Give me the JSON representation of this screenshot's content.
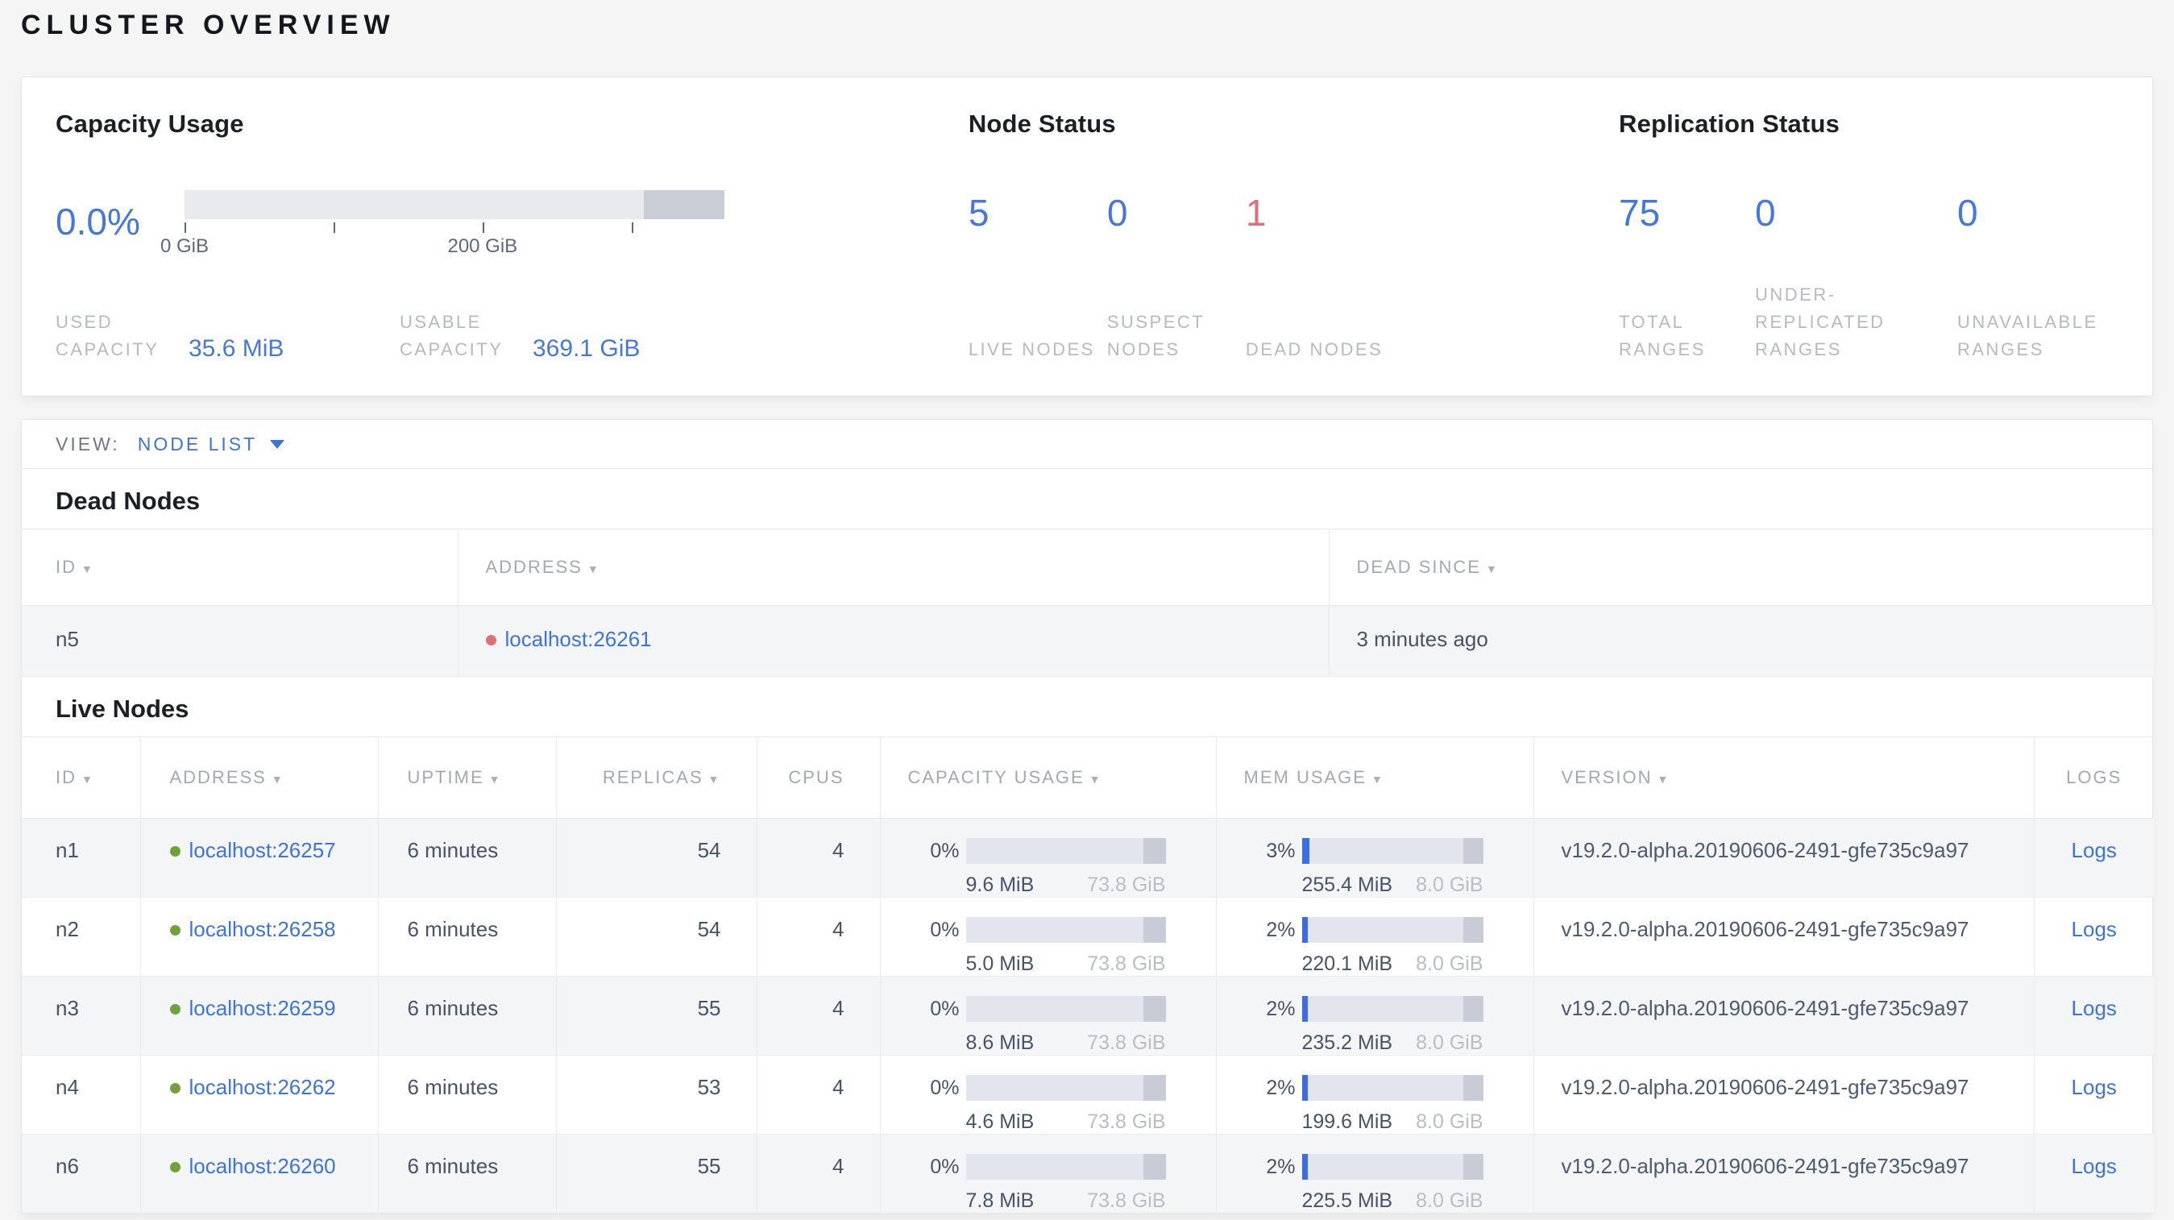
{
  "page": {
    "title": "CLUSTER OVERVIEW"
  },
  "colors": {
    "accent_blue": "#4577df",
    "link_blue": "#3d74db",
    "dead_red": "#df6e7e",
    "live_dot_green": "#6fa33a",
    "dead_dot_red": "#df7072",
    "muted_label_gray": "#b5b9c1",
    "bar_track": "#e2e5ed",
    "bar_reserved": "#c7ccd6"
  },
  "icons": {
    "sort_desc": "▼"
  },
  "summary": {
    "capacity": {
      "title": "Capacity Usage",
      "percent": "0.0%",
      "axis_ticks": [
        {
          "pos_pct": 0,
          "label": "0 GiB"
        },
        {
          "pos_pct": 27.6,
          "label": ""
        },
        {
          "pos_pct": 55.2,
          "label": "200 GiB"
        },
        {
          "pos_pct": 82.8,
          "label": ""
        }
      ],
      "used": {
        "label": "USED CAPACITY",
        "value": "35.6 MiB"
      },
      "usable": {
        "label": "USABLE CAPACITY",
        "value": "369.1 GiB"
      }
    },
    "node_status": {
      "title": "Node Status",
      "stats": [
        {
          "value": "5",
          "label": "LIVE NODES",
          "status": "live"
        },
        {
          "value": "0",
          "label": "SUSPECT NODES",
          "status": "suspect"
        },
        {
          "value": "1",
          "label": "DEAD NODES",
          "status": "dead"
        }
      ]
    },
    "replication": {
      "title": "Replication Status",
      "stats": [
        {
          "value": "75",
          "label": "TOTAL RANGES"
        },
        {
          "value": "0",
          "label": "UNDER-REPLICATED RANGES"
        },
        {
          "value": "0",
          "label": "UNAVAILABLE RANGES"
        }
      ]
    }
  },
  "view_bar": {
    "label": "VIEW:",
    "selected": "NODE LIST"
  },
  "dead_nodes": {
    "title": "Dead Nodes",
    "headers": {
      "id": "ID",
      "address": "ADDRESS",
      "dead_since": "DEAD SINCE"
    },
    "rows": [
      {
        "id": "n5",
        "address": "localhost:26261",
        "dead_since": "3 minutes ago"
      }
    ]
  },
  "live_nodes": {
    "title": "Live Nodes",
    "headers": {
      "id": "ID",
      "address": "ADDRESS",
      "uptime": "UPTIME",
      "replicas": "REPLICAS",
      "cpus": "CPUS",
      "capacity": "CAPACITY USAGE",
      "mem": "MEM USAGE",
      "version": "VERSION",
      "logs": "LOGS"
    },
    "rows": [
      {
        "id": "n1",
        "address": "localhost:26257",
        "uptime": "6 minutes",
        "replicas": "54",
        "cpus": "4",
        "cap_pct": "0%",
        "cap_used": "9.6 MiB",
        "cap_total": "73.8 GiB",
        "mem_pct": "3%",
        "mem_used": "255.4 MiB",
        "mem_total": "8.0 GiB",
        "version": "v19.2.0-alpha.20190606-2491-gfe735c9a97",
        "logs": "Logs"
      },
      {
        "id": "n2",
        "address": "localhost:26258",
        "uptime": "6 minutes",
        "replicas": "54",
        "cpus": "4",
        "cap_pct": "0%",
        "cap_used": "5.0 MiB",
        "cap_total": "73.8 GiB",
        "mem_pct": "2%",
        "mem_used": "220.1 MiB",
        "mem_total": "8.0 GiB",
        "version": "v19.2.0-alpha.20190606-2491-gfe735c9a97",
        "logs": "Logs"
      },
      {
        "id": "n3",
        "address": "localhost:26259",
        "uptime": "6 minutes",
        "replicas": "55",
        "cpus": "4",
        "cap_pct": "0%",
        "cap_used": "8.6 MiB",
        "cap_total": "73.8 GiB",
        "mem_pct": "2%",
        "mem_used": "235.2 MiB",
        "mem_total": "8.0 GiB",
        "version": "v19.2.0-alpha.20190606-2491-gfe735c9a97",
        "logs": "Logs"
      },
      {
        "id": "n4",
        "address": "localhost:26262",
        "uptime": "6 minutes",
        "replicas": "53",
        "cpus": "4",
        "cap_pct": "0%",
        "cap_used": "4.6 MiB",
        "cap_total": "73.8 GiB",
        "mem_pct": "2%",
        "mem_used": "199.6 MiB",
        "mem_total": "8.0 GiB",
        "version": "v19.2.0-alpha.20190606-2491-gfe735c9a97",
        "logs": "Logs"
      },
      {
        "id": "n6",
        "address": "localhost:26260",
        "uptime": "6 minutes",
        "replicas": "55",
        "cpus": "4",
        "cap_pct": "0%",
        "cap_used": "7.8 MiB",
        "cap_total": "73.8 GiB",
        "mem_pct": "2%",
        "mem_used": "225.5 MiB",
        "mem_total": "8.0 GiB",
        "version": "v19.2.0-alpha.20190606-2491-gfe735c9a97",
        "logs": "Logs"
      }
    ]
  }
}
